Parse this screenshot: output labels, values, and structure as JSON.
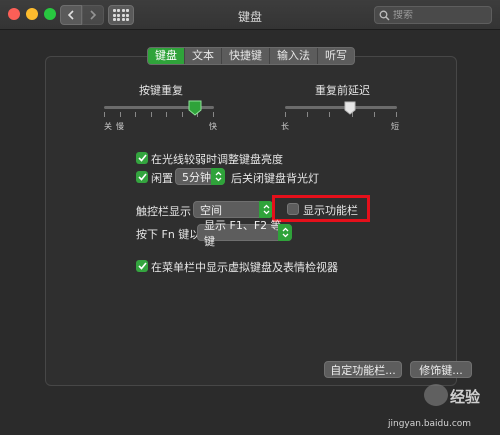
{
  "window": {
    "title": "键盘"
  },
  "search": {
    "placeholder": "搜索"
  },
  "tabs": [
    {
      "label": "键盘",
      "active": true
    },
    {
      "label": "文本",
      "active": false
    },
    {
      "label": "快捷键",
      "active": false
    },
    {
      "label": "输入法",
      "active": false
    },
    {
      "label": "听写",
      "active": false
    }
  ],
  "key_repeat": {
    "label": "按键重复",
    "left_label": "关",
    "left_label2": "慢",
    "right_label": "快",
    "level": 0.92
  },
  "delay_until_repeat": {
    "label": "重复前延迟",
    "left_label": "长",
    "right_label": "短",
    "level": 0.75
  },
  "options": {
    "adjust_brightness": {
      "label": "在光线较弱时调整键盘亮度",
      "checked": true
    },
    "backlight_off": {
      "prefix": "闲置",
      "value": "5分钟",
      "suffix": "后关闭键盘背光灯",
      "checked": true
    },
    "touchbar_shows": {
      "label": "触控栏显示",
      "value": "空间"
    },
    "show_control_strip": {
      "label": "显示功能栏",
      "checked": false
    },
    "fn_key": {
      "label": "按下 Fn 键以",
      "value": "显示 F1、F2 等键"
    },
    "show_viewers": {
      "label": "在菜单栏中显示虚拟键盘及表情检视器",
      "checked": true
    }
  },
  "buttons": {
    "customize_control_strip": "自定功能栏...",
    "modifier_keys": "修饰键..."
  },
  "watermark": {
    "brand": "经验",
    "url": "jingyan.baidu.com"
  },
  "colors": {
    "accent": "#2fa33a",
    "highlight": "#e5101b",
    "background": "#2b2b2b"
  }
}
